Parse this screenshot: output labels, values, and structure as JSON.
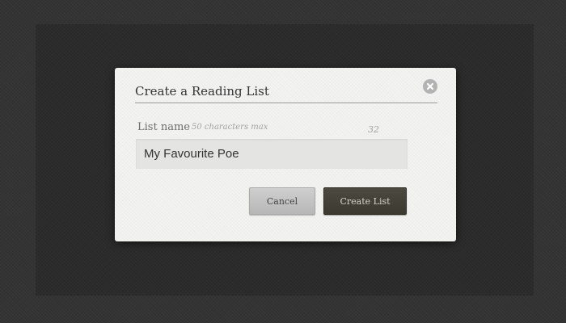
{
  "dialog": {
    "title": "Create a Reading List",
    "close_icon": "close-circle-icon",
    "field": {
      "label": "List name",
      "hint": "50 characters max",
      "remaining": "32",
      "value": "My Favourite Poe"
    },
    "buttons": {
      "cancel": "Cancel",
      "create": "Create List"
    }
  },
  "colors": {
    "page_background": "#333333",
    "dialog_background": "#f3f3f1",
    "primary_button": "#43413a",
    "secondary_button": "#c2c2c2"
  }
}
